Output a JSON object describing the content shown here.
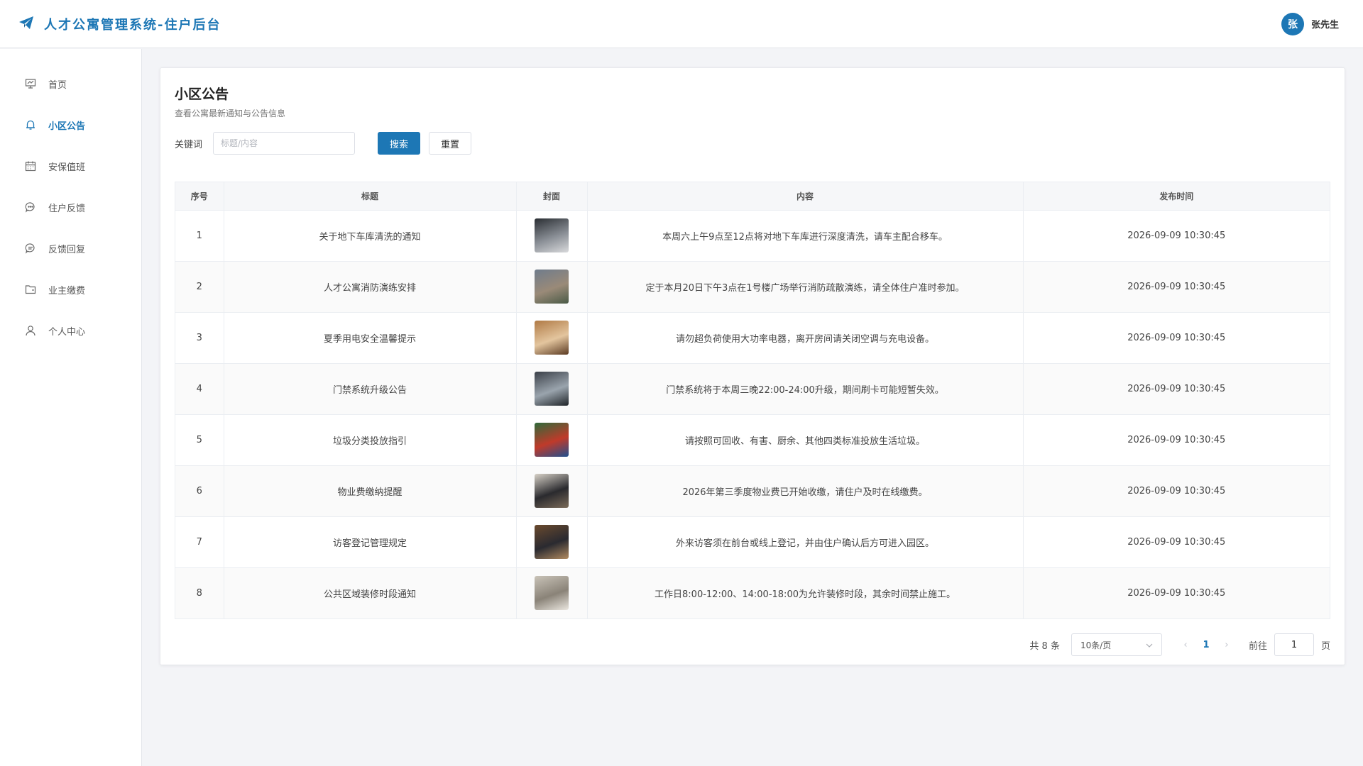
{
  "header": {
    "title": "人才公寓管理系统-住户后台",
    "user_avatar": "张",
    "user_name": "张先生"
  },
  "sidebar": {
    "items": [
      {
        "label": "首页",
        "icon": "home-board-icon",
        "active": false
      },
      {
        "label": "小区公告",
        "icon": "bell-icon",
        "active": true
      },
      {
        "label": "安保值班",
        "icon": "calendar-icon",
        "active": false
      },
      {
        "label": "住户反馈",
        "icon": "chat-bubble-icon",
        "active": false
      },
      {
        "label": "反馈回复",
        "icon": "reply-bubble-icon",
        "active": false
      },
      {
        "label": "业主缴费",
        "icon": "folder-icon",
        "active": false
      },
      {
        "label": "个人中心",
        "icon": "user-icon",
        "active": false
      }
    ]
  },
  "main": {
    "title": "小区公告",
    "subtitle": "查看公寓最新通知与公告信息",
    "search": {
      "label": "关键词",
      "placeholder": "标题/内容",
      "value": "",
      "search_button": "搜索",
      "reset_button": "重置"
    },
    "table": {
      "columns": [
        "序号",
        "标题",
        "封面",
        "内容",
        "发布时间"
      ],
      "rows": [
        {
          "index": "1",
          "title": "关于地下车库清洗的通知",
          "content": "本周六上午9点至12点将对地下车库进行深度清洗，请车主配合移车。",
          "time": "2026-09-09 10:30:45",
          "cover_colors": [
            "#2a2e33",
            "#8a8f96",
            "#d9dadc"
          ]
        },
        {
          "index": "2",
          "title": "人才公寓消防演练安排",
          "content": "定于本月20日下午3点在1号楼广场举行消防疏散演练，请全体住户准时参加。",
          "time": "2026-09-09 10:30:45",
          "cover_colors": [
            "#6f7c8c",
            "#9a8a78",
            "#4a5a46"
          ]
        },
        {
          "index": "3",
          "title": "夏季用电安全温馨提示",
          "content": "请勿超负荷使用大功率电器，离开房间请关闭空调与充电设备。",
          "time": "2026-09-09 10:30:45",
          "cover_colors": [
            "#b07a45",
            "#e3c59e",
            "#5b3a22"
          ]
        },
        {
          "index": "4",
          "title": "门禁系统升级公告",
          "content": "门禁系统将于本周三晚22:00-24:00升级，期间刷卡可能短暂失效。",
          "time": "2026-09-09 10:30:45",
          "cover_colors": [
            "#3b4048",
            "#9aa4ad",
            "#1f2428"
          ]
        },
        {
          "index": "5",
          "title": "垃圾分类投放指引",
          "content": "请按照可回收、有害、厨余、其他四类标准投放生活垃圾。",
          "time": "2026-09-09 10:30:45",
          "cover_colors": [
            "#2e6a3a",
            "#c03a2a",
            "#1f4f8f"
          ]
        },
        {
          "index": "6",
          "title": "物业费缴纳提醒",
          "content": "2026年第三季度物业费已开始收缴，请住户及时在线缴费。",
          "time": "2026-09-09 10:30:45",
          "cover_colors": [
            "#d8d2c8",
            "#2a2a2e",
            "#7a6a58"
          ]
        },
        {
          "index": "7",
          "title": "访客登记管理规定",
          "content": "外来访客须在前台或线上登记，并由住户确认后方可进入园区。",
          "time": "2026-09-09 10:30:45",
          "cover_colors": [
            "#6a4a2e",
            "#2a2a30",
            "#b08a60"
          ]
        },
        {
          "index": "8",
          "title": "公共区域装修时段通知",
          "content": "工作日8:00-12:00、14:00-18:00为允许装修时段，其余时间禁止施工。",
          "time": "2026-09-09 10:30:45",
          "cover_colors": [
            "#c9c3b8",
            "#8a8378",
            "#eae6df"
          ]
        }
      ]
    },
    "pagination": {
      "total": "共 8 条",
      "page_size": "10条/页",
      "current": "1",
      "goto_label": "前往",
      "goto_value": "1",
      "page_suffix": "页"
    }
  },
  "colors": {
    "accent": "#1d77b5",
    "page_bg": "#f3f4f7"
  }
}
